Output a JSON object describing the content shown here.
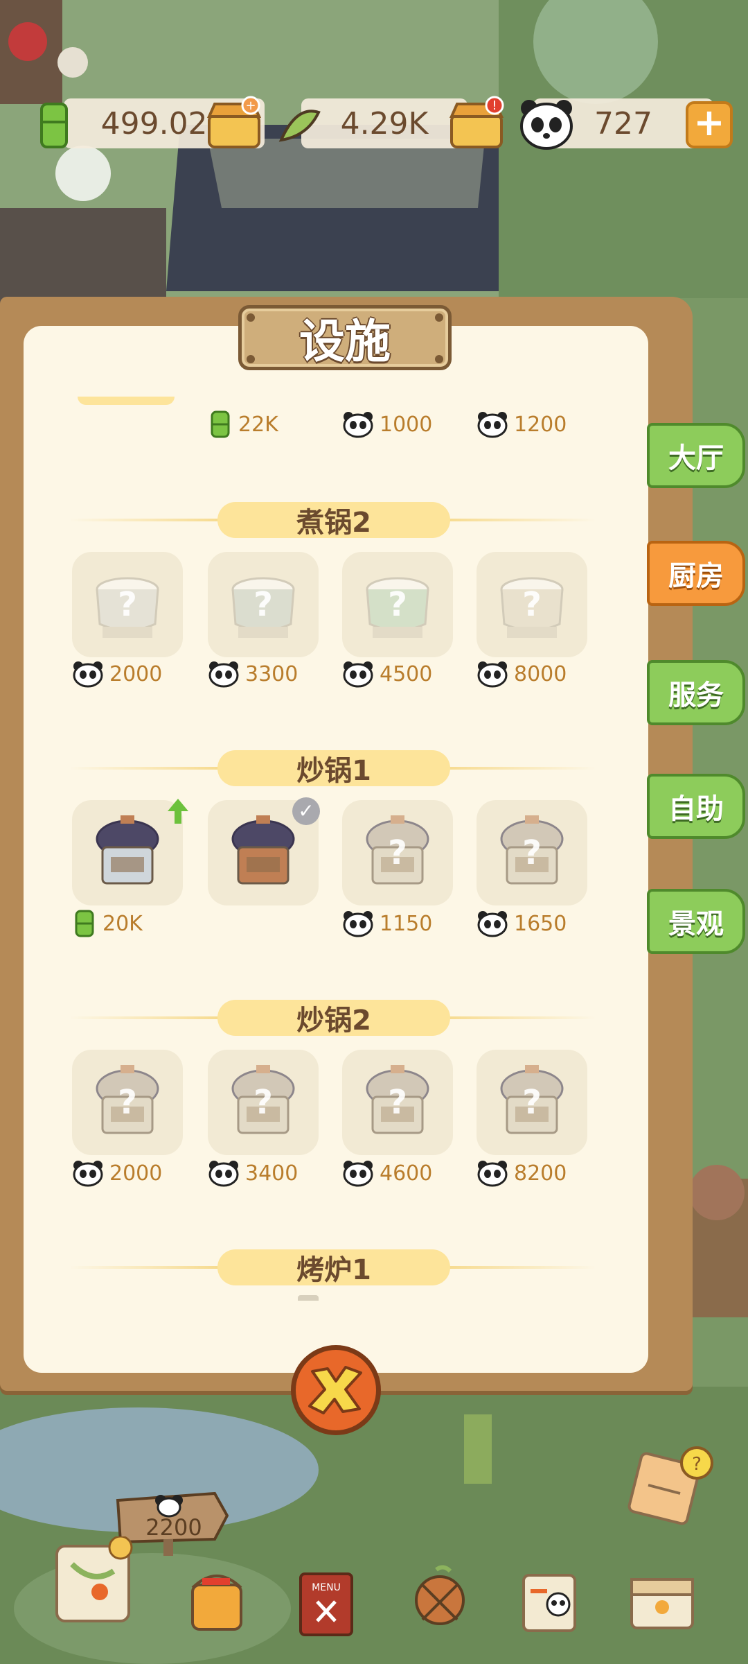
{
  "colors": {
    "accent_orange": "#f79a3d",
    "tab_green": "#8dcc5b",
    "price_text": "#b97d2c",
    "paper": "#fdf7e6",
    "section_pill": "#fde49a"
  },
  "top_bar": {
    "bamboo_amount": "499.02K",
    "leaf_amount": "4.29K",
    "panda_amount": "727",
    "add_label": "+"
  },
  "panel": {
    "title": "设施",
    "top_row_prices": [
      {
        "currency": "bamboo-icon",
        "amount": "22K"
      },
      {
        "currency": "panda-icon",
        "amount": "1000"
      },
      {
        "currency": "panda-icon",
        "amount": "1200"
      }
    ],
    "sections": [
      {
        "title": "煮锅2",
        "items": [
          {
            "state": "locked",
            "currency": "panda-icon",
            "price": "2000"
          },
          {
            "state": "locked",
            "currency": "panda-icon",
            "price": "3300"
          },
          {
            "state": "locked",
            "currency": "panda-icon",
            "price": "4500"
          },
          {
            "state": "locked",
            "currency": "panda-icon",
            "price": "8000"
          }
        ]
      },
      {
        "title": "炒锅1",
        "items": [
          {
            "state": "owned-upgradable",
            "currency": "bamboo-icon",
            "price": "20K"
          },
          {
            "state": "equipped",
            "currency": "",
            "price": ""
          },
          {
            "state": "locked",
            "currency": "panda-icon",
            "price": "1150"
          },
          {
            "state": "locked",
            "currency": "panda-icon",
            "price": "1650"
          }
        ]
      },
      {
        "title": "炒锅2",
        "items": [
          {
            "state": "locked",
            "currency": "panda-icon",
            "price": "2000"
          },
          {
            "state": "locked",
            "currency": "panda-icon",
            "price": "3400"
          },
          {
            "state": "locked",
            "currency": "panda-icon",
            "price": "4600"
          },
          {
            "state": "locked",
            "currency": "panda-icon",
            "price": "8200"
          }
        ]
      },
      {
        "title": "烤炉1",
        "items": []
      }
    ],
    "locked_mark": "?",
    "close_icon": "close-x-icon"
  },
  "side_tabs": [
    {
      "label": "大厅",
      "active": false
    },
    {
      "label": "厨房",
      "active": true
    },
    {
      "label": "服务",
      "active": false
    },
    {
      "label": "自助",
      "active": false
    },
    {
      "label": "景观",
      "active": false
    }
  ],
  "bottom_hud": {
    "sign_value": "2200",
    "icons": [
      "map-icon",
      "paint-bucket-icon",
      "menu-book-icon",
      "decor-icon",
      "panda-card-icon",
      "treasure-box-icon",
      "task-notepad-icon"
    ]
  }
}
